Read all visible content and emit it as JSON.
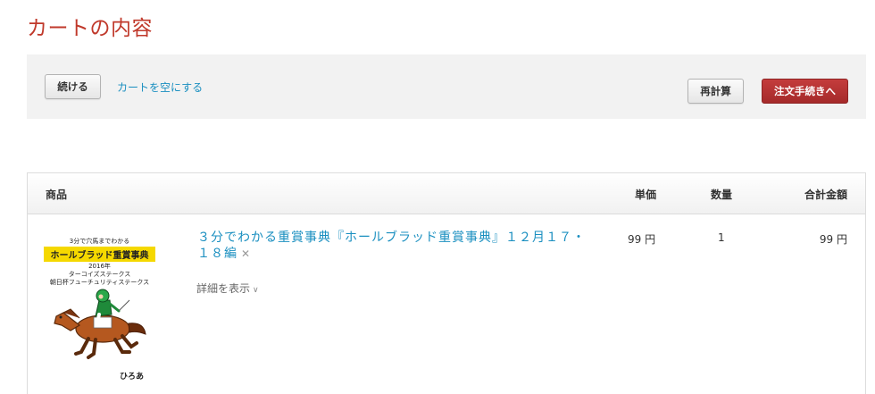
{
  "page": {
    "title": "カートの内容"
  },
  "toolbar": {
    "continue_label": "続ける",
    "empty_cart_label": "カートを空にする",
    "recalc_label": "再計算",
    "checkout_label": "注文手続きへ"
  },
  "table": {
    "headers": {
      "product": "商品",
      "unit_price": "単価",
      "quantity": "数量",
      "total": "合計金額"
    },
    "items": [
      {
        "title": "３分でわかる重賞事典『ホールブラッド重賞事典』１２月１７・１８編",
        "remove_icon": "close-icon",
        "details_label": "詳細を表示",
        "unit_price": "99 円",
        "quantity": "1",
        "total": "99 円",
        "cover": {
          "line1": "3分で穴馬までわかる",
          "title": "ホールブラッド重賞事典",
          "year": "2016年",
          "race1": "ターコイズステークス",
          "race2": "朝日杯フューチュリティステークス",
          "author": "ひろあ"
        }
      }
    ]
  },
  "colors": {
    "title_red": "#c0392b",
    "link_blue": "#1a8fc0",
    "checkout_red": "#b03333",
    "cover_yellow": "#f5d800"
  }
}
